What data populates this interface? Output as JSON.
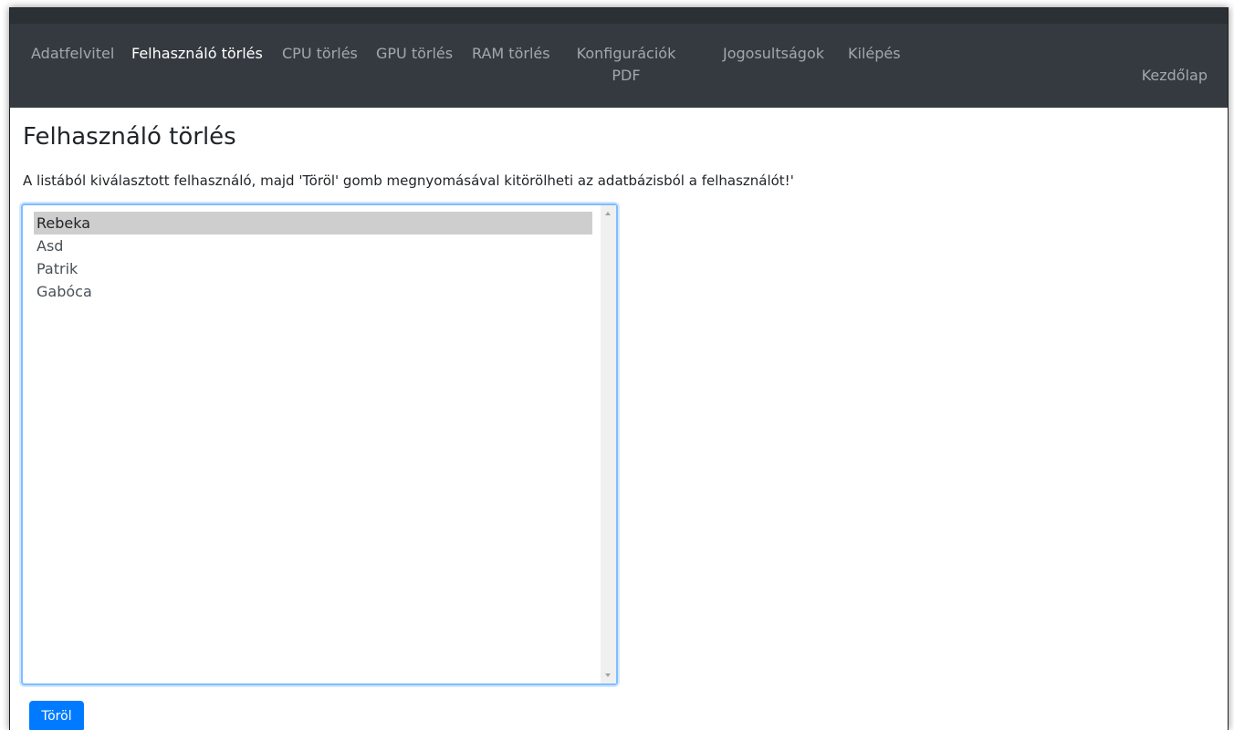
{
  "nav": {
    "items": [
      {
        "label": "Adatfelvitel",
        "active": false
      },
      {
        "label": "Felhasználó törlés",
        "active": true
      },
      {
        "label": "CPU törlés",
        "active": false
      },
      {
        "label": "GPU törlés",
        "active": false
      },
      {
        "label": "RAM törlés",
        "active": false
      },
      {
        "label_line1": "Konfigurációk",
        "label_line2": "PDF",
        "active": false
      },
      {
        "label": "Jogosultságok",
        "active": false
      },
      {
        "label": "Kilépés",
        "active": false
      }
    ],
    "right_link": "Kezdőlap"
  },
  "page": {
    "title": "Felhasználó törlés",
    "description": "A listából kiválasztott felhasználó, majd 'Töröl' gomb megnyomásával kitörölheti az adatbázisból a felhasználót!'"
  },
  "user_list": {
    "items": [
      "Rebeka",
      "Asd",
      "Patrik",
      "Gabóca"
    ],
    "selected": "Rebeka"
  },
  "delete_button": {
    "label": "Töröl"
  },
  "colors": {
    "navbar_bg": "#343a40",
    "primary": "#007bff",
    "selected_bg": "#cecece",
    "focus_border": "#80bdff"
  },
  "icons": {
    "scroll_up": "scroll-up-arrow-icon",
    "scroll_down": "scroll-down-arrow-icon"
  }
}
